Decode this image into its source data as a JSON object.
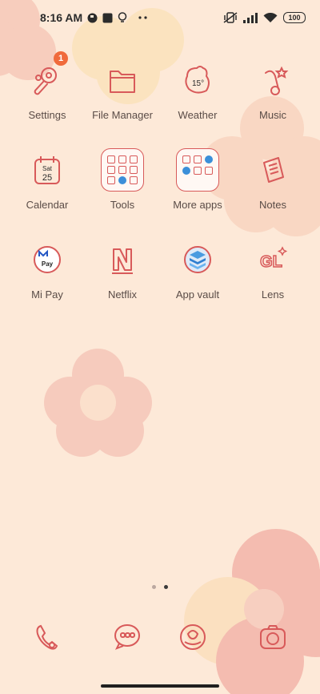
{
  "status_bar": {
    "time": "8:16 AM",
    "battery": "100",
    "icons": [
      "circle-app-icon",
      "square-app-icon",
      "bulb-icon",
      "more-dots-icon",
      "vibrate-icon",
      "signal-icon",
      "wifi-icon",
      "battery-icon"
    ]
  },
  "apps": [
    {
      "label": "Settings",
      "icon": "settings-icon",
      "badge": "1"
    },
    {
      "label": "File Manager",
      "icon": "folder-icon"
    },
    {
      "label": "Weather",
      "icon": "weather-icon",
      "temp": "15°"
    },
    {
      "label": "Music",
      "icon": "music-icon"
    },
    {
      "label": "Calendar",
      "icon": "calendar-icon",
      "day": "Sat",
      "date": "25"
    },
    {
      "label": "Tools",
      "icon": "tools-folder-icon"
    },
    {
      "label": "More apps",
      "icon": "more-apps-folder-icon"
    },
    {
      "label": "Notes",
      "icon": "notes-icon"
    },
    {
      "label": "Mi Pay",
      "icon": "mi-pay-icon",
      "pay": "Pay"
    },
    {
      "label": "Netflix",
      "icon": "netflix-icon"
    },
    {
      "label": "App vault",
      "icon": "app-vault-icon"
    },
    {
      "label": "Lens",
      "icon": "lens-icon",
      "text": "GL"
    }
  ],
  "dock": [
    {
      "icon": "phone-icon"
    },
    {
      "icon": "messages-icon"
    },
    {
      "icon": "browser-icon"
    },
    {
      "icon": "camera-icon"
    }
  ],
  "colors": {
    "background": "#fde9d8",
    "icon_stroke": "#d85a5a",
    "badge": "#f06a3b",
    "label": "#5a4c47"
  }
}
